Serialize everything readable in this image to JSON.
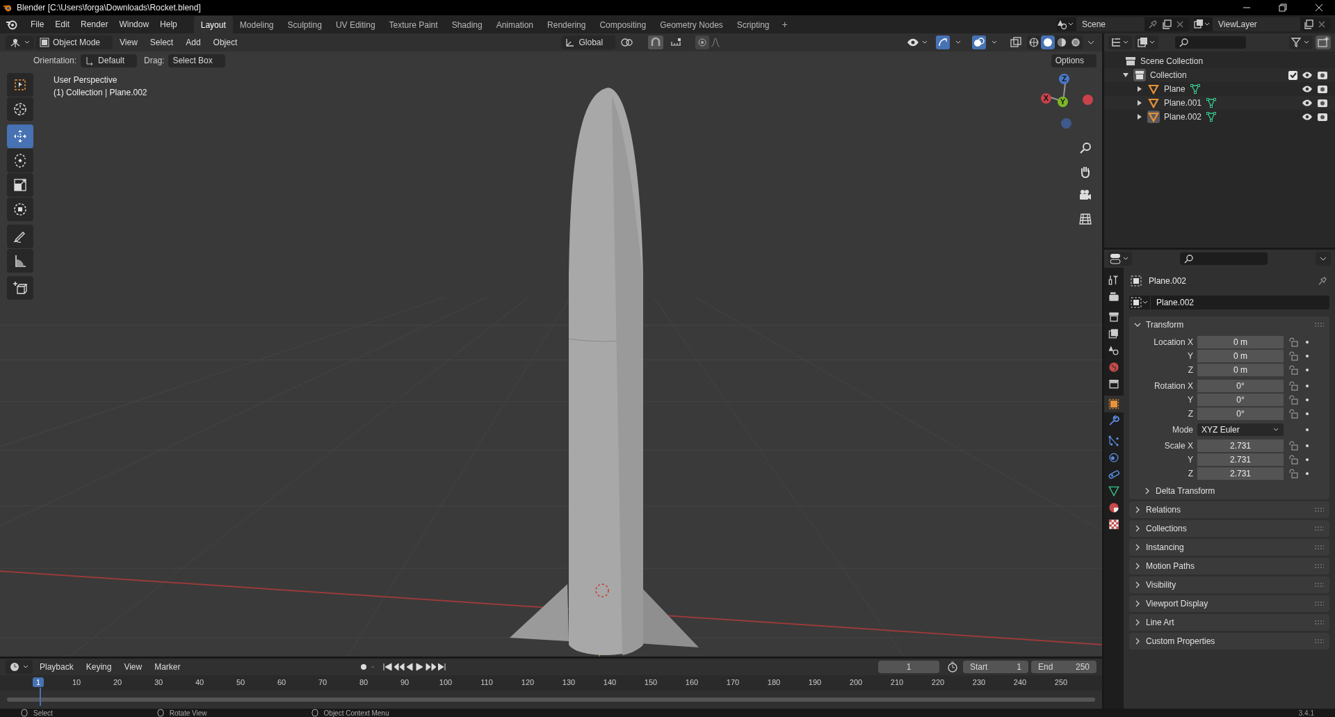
{
  "window": {
    "title": "Blender [C:\\Users\\forga\\Downloads\\Rocket.blend]"
  },
  "menu": [
    "File",
    "Edit",
    "Render",
    "Window",
    "Help"
  ],
  "workspaces": [
    {
      "label": "Layout",
      "selected": true
    },
    {
      "label": "Modeling",
      "selected": false
    },
    {
      "label": "Sculpting",
      "selected": false
    },
    {
      "label": "UV Editing",
      "selected": false
    },
    {
      "label": "Texture Paint",
      "selected": false
    },
    {
      "label": "Shading",
      "selected": false
    },
    {
      "label": "Animation",
      "selected": false
    },
    {
      "label": "Rendering",
      "selected": false
    },
    {
      "label": "Compositing",
      "selected": false
    },
    {
      "label": "Geometry Nodes",
      "selected": false
    },
    {
      "label": "Scripting",
      "selected": false
    }
  ],
  "add_workspace": "+",
  "scene": {
    "name": "Scene"
  },
  "view_layer": {
    "name": "ViewLayer"
  },
  "viewport": {
    "mode": "Object Mode",
    "menu": [
      "View",
      "Select",
      "Add",
      "Object"
    ],
    "transform_orientation": "Global",
    "orientation_label": "Orientation:",
    "orientation": "Default",
    "drag_label": "Drag:",
    "drag": "Select Box",
    "options": "Options",
    "overlay_info": [
      "User Perspective",
      "(1) Collection | Plane.002"
    ],
    "tools": [
      {
        "kind": "select",
        "selected": false
      },
      {
        "kind": "cursor",
        "selected": false
      },
      {
        "kind": "move",
        "selected": true
      },
      {
        "kind": "rotate",
        "selected": false
      },
      {
        "kind": "scale",
        "selected": false
      },
      {
        "kind": "transform",
        "selected": false
      },
      {
        "kind": "annotate",
        "selected": false
      },
      {
        "kind": "measure",
        "selected": false
      },
      {
        "kind": "add_cube",
        "selected": false
      }
    ],
    "shading": [
      {
        "kind": "wireframe",
        "selected": false
      },
      {
        "kind": "solid",
        "selected": true
      },
      {
        "kind": "material",
        "selected": false
      },
      {
        "kind": "rendered",
        "selected": false
      }
    ],
    "gizmo": {
      "x": "X",
      "y": "Y",
      "z": "Z"
    }
  },
  "outliner": {
    "root": "Scene Collection",
    "collections": [
      {
        "name": "Collection",
        "expanded": true,
        "checked": true,
        "children": [
          {
            "name": "Plane",
            "selected": false
          },
          {
            "name": "Plane.001",
            "selected": false
          },
          {
            "name": "Plane.002",
            "selected": true
          }
        ]
      }
    ]
  },
  "properties": {
    "tabs": [
      {
        "kind": "tool",
        "selected": false
      },
      {
        "kind": "render",
        "selected": false
      },
      {
        "kind": "output",
        "selected": false
      },
      {
        "kind": "view_layer",
        "selected": false
      },
      {
        "kind": "scene",
        "selected": false
      },
      {
        "kind": "world",
        "selected": false
      },
      {
        "kind": "collection",
        "selected": false
      },
      {
        "kind": "object",
        "selected": true
      },
      {
        "kind": "modifiers",
        "selected": false
      },
      {
        "kind": "particles",
        "selected": false
      },
      {
        "kind": "physics",
        "selected": false
      },
      {
        "kind": "constraints",
        "selected": false
      },
      {
        "kind": "data",
        "selected": false
      },
      {
        "kind": "material",
        "selected": false
      },
      {
        "kind": "texture",
        "selected": false
      }
    ],
    "object_name": "Plane.002",
    "data_name": "Plane.002",
    "transform": {
      "title": "Transform",
      "expanded": true,
      "location": {
        "label": "Location",
        "rows": [
          {
            "axis": "X",
            "value": "0 m"
          },
          {
            "axis": "Y",
            "value": "0 m"
          },
          {
            "axis": "Z",
            "value": "0 m"
          }
        ]
      },
      "rotation": {
        "label": "Rotation",
        "rows": [
          {
            "axis": "X",
            "value": "0°"
          },
          {
            "axis": "Y",
            "value": "0°"
          },
          {
            "axis": "Z",
            "value": "0°"
          }
        ]
      },
      "mode_label": "Mode",
      "mode": "XYZ Euler",
      "scale": {
        "label": "Scale",
        "rows": [
          {
            "axis": "X",
            "value": "2.731"
          },
          {
            "axis": "Y",
            "value": "2.731"
          },
          {
            "axis": "Z",
            "value": "2.731"
          }
        ]
      },
      "subpanel": "Delta Transform"
    },
    "panels": [
      "Relations",
      "Collections",
      "Instancing",
      "Motion Paths",
      "Visibility",
      "Viewport Display",
      "Line Art",
      "Custom Properties"
    ]
  },
  "timeline": {
    "menu": [
      "Playback",
      "Keying",
      "View",
      "Marker"
    ],
    "current_frame": "1",
    "start_label": "Start",
    "start": "1",
    "end_label": "End",
    "end": "250",
    "playhead": "1",
    "ticks": [
      "10",
      "20",
      "30",
      "40",
      "50",
      "60",
      "70",
      "80",
      "90",
      "100",
      "110",
      "120",
      "130",
      "140",
      "150",
      "160",
      "170",
      "180",
      "190",
      "200",
      "210",
      "220",
      "230",
      "240",
      "250"
    ]
  },
  "status_bar": {
    "hints": [
      "Select",
      "Rotate View",
      "Object Context Menu"
    ],
    "version": "3.4.1"
  }
}
